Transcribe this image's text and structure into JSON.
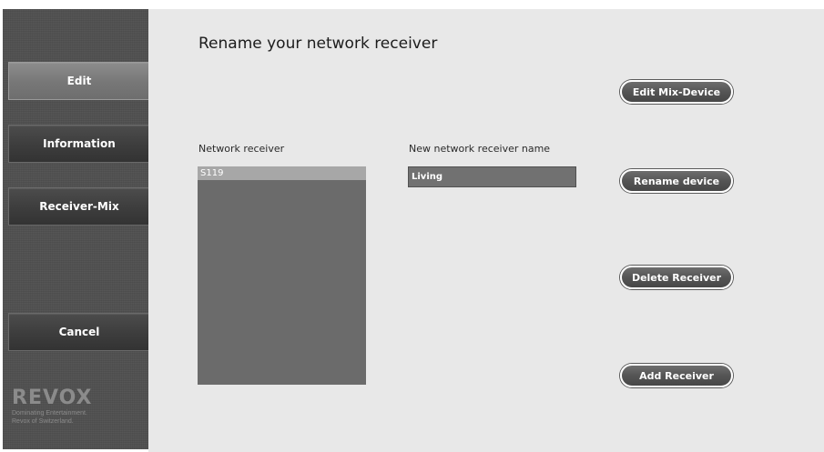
{
  "sidebar": {
    "buttons": [
      {
        "label": "Edit",
        "selected": true
      },
      {
        "label": "Information",
        "selected": false
      },
      {
        "label": "Receiver-Mix",
        "selected": false
      },
      {
        "label": "Cancel",
        "selected": false
      }
    ],
    "brand": {
      "logo": "REVOX",
      "line1": "Dominating Entertainment.",
      "line2": "Revox of Switzerland."
    }
  },
  "main": {
    "title": "Rename your network receiver",
    "receiver_list": {
      "label": "Network receiver",
      "items": [
        {
          "label": "S119",
          "selected": true
        }
      ]
    },
    "name_field": {
      "label": "New network receiver name",
      "value": "Living"
    },
    "actions": {
      "edit_mix": "Edit Mix-Device",
      "rename": "Rename device",
      "delete": "Delete Receiver",
      "add": "Add Receiver"
    }
  },
  "colors": {
    "sidebar_bg": "#505050",
    "content_bg": "#e8e8e8",
    "list_bg": "#6b6b6b",
    "list_selected": "#a7a7a7"
  }
}
